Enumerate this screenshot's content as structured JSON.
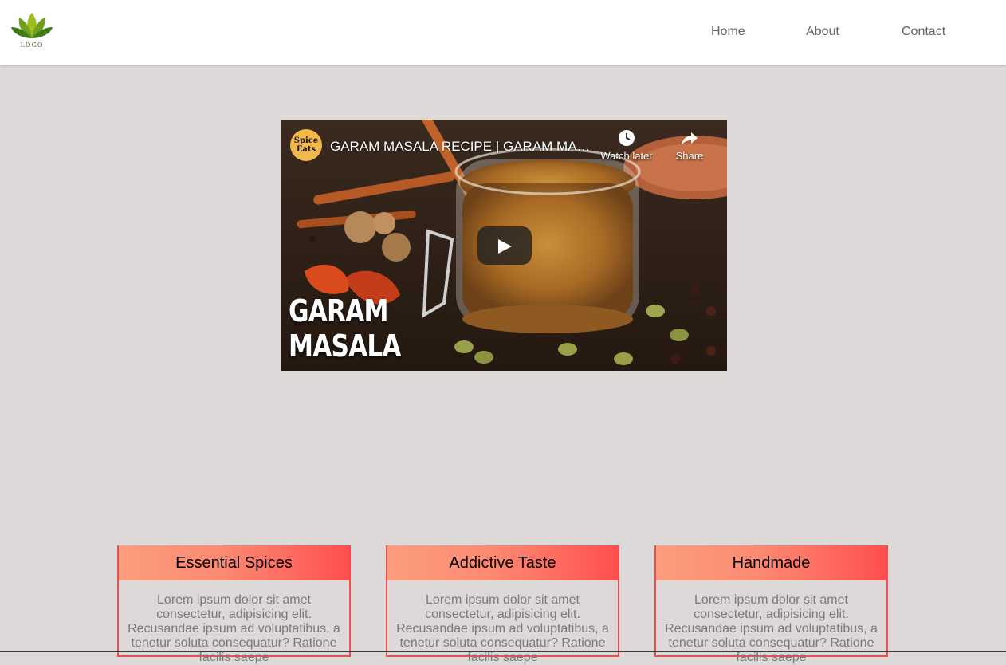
{
  "logo": {
    "text": "LOGO"
  },
  "nav": {
    "items": [
      "Home",
      "About",
      "Contact"
    ]
  },
  "video": {
    "channel_badge": "Spice Eats",
    "title": "GARAM MASALA RECIPE | GARAM MA…",
    "watch_later_label": "Watch later",
    "share_label": "Share",
    "overlay_line1": "GARAM",
    "overlay_line2": "MASALA"
  },
  "features": [
    {
      "title": "Essential Spices",
      "text": "Lorem ipsum dolor sit amet consectetur, adipisicing elit. Recusandae ipsum ad voluptatibus, a tenetur soluta consequatur? Ratione facilis saepe"
    },
    {
      "title": "Addictive Taste",
      "text": "Lorem ipsum dolor sit amet consectetur, adipisicing elit. Recusandae ipsum ad voluptatibus, a tenetur soluta consequatur? Ratione facilis saepe"
    },
    {
      "title": "Handmade",
      "text": "Lorem ipsum dolor sit amet consectetur, adipisicing elit. Recusandae ipsum ad voluptatibus, a tenetur soluta consequatur? Ratione facilis saepe"
    }
  ],
  "colors": {
    "page_bg": "#dcd9d8",
    "card_border": "#f04e4e",
    "card_gradient_start": "#fb9d7f",
    "card_gradient_end": "#ff4f4f",
    "nav_text": "#666666"
  },
  "icons": [
    "lotus-logo-icon",
    "clock-icon",
    "share-icon",
    "play-icon"
  ]
}
